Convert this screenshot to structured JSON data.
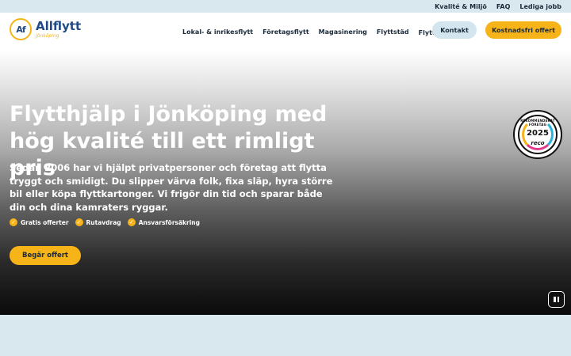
{
  "topbar": {
    "links": [
      "Kvalité & Miljö",
      "FAQ",
      "Lediga jobb"
    ]
  },
  "header": {
    "logo": {
      "mark": "Af",
      "name": "Allflytt",
      "sub": "Jönköping"
    },
    "nav": [
      "Lokal- & inrikesflytt",
      "Företagsflytt",
      "Magasinering",
      "Flyttstäd",
      "Flyttråd"
    ],
    "contact_label": "Kontakt",
    "quote_label": "Kostnadsfri offert"
  },
  "hero": {
    "title": "Flytthjälp i Jönköping med hög kvalité till ett rimligt pris",
    "description": "Sedan 2006 har vi hjälpt privatpersoner och företag att flytta tryggt och smidigt. Du slipper värva folk, fixa släp, hyra större bil eller köpa flyttkartonger. Vi frigör din tid och sparar både din och dina kamraters ryggar.",
    "features": [
      "Gratis offerter",
      "Rutavdrag",
      "Ansvarsförsäkring"
    ],
    "cta_label": "Begär offert"
  },
  "badge": {
    "top_text": "REKOMMENDERAT FÖRETAG",
    "year": "2025",
    "brand": "reco"
  },
  "colors": {
    "accent": "#f6b419",
    "brand": "#1f4a86",
    "topbar": "#d9e8ef"
  }
}
